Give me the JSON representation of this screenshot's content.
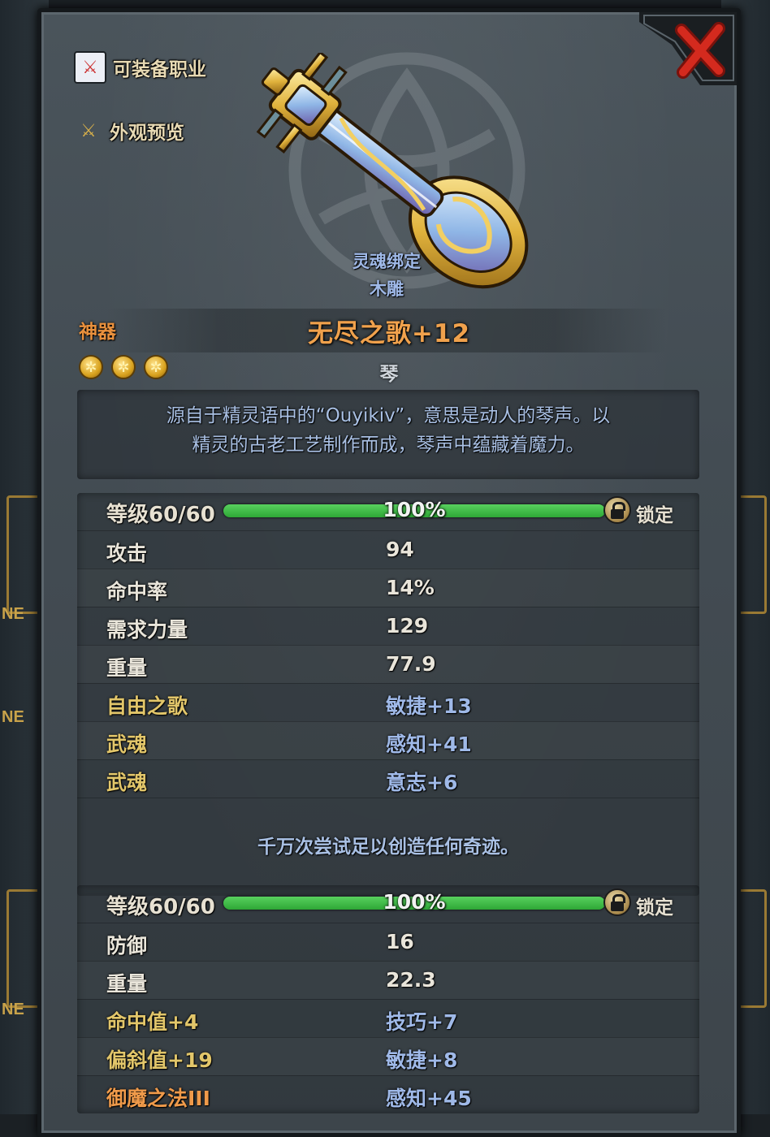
{
  "side_buttons": {
    "equip_class": "可装备职业",
    "appearance_preview": "外观预览"
  },
  "item": {
    "bind_status": "灵魂绑定",
    "material": "木雕",
    "rarity": "神器",
    "name": "无尽之歌+12",
    "type": "琴",
    "star_count": 3,
    "description_line1": "源自于精灵语中的“Ouyikiv”，意思是动人的琴声。以",
    "description_line2": "精灵的古老工艺制作而成，琴声中蕴藏着魔力。"
  },
  "weapon_section": {
    "level_label": "等级60/60",
    "progress_percent": 100,
    "progress_text": "100%",
    "lock_label": "锁定",
    "stats": [
      {
        "name": "攻击",
        "value": "94",
        "name_color": "white",
        "value_color": "white"
      },
      {
        "name": "命中率",
        "value": "14%",
        "name_color": "white",
        "value_color": "white"
      },
      {
        "name": "需求力量",
        "value": "129",
        "name_color": "white",
        "value_color": "white"
      },
      {
        "name": "重量",
        "value": "77.9",
        "name_color": "white",
        "value_color": "white"
      },
      {
        "name": "自由之歌",
        "value": "敏捷+13",
        "name_color": "gold",
        "value_color": "blue"
      },
      {
        "name": "武魂",
        "value": "感知+41",
        "name_color": "gold",
        "value_color": "blue"
      },
      {
        "name": "武魂",
        "value": "意志+6",
        "name_color": "gold",
        "value_color": "blue"
      }
    ],
    "flavor_text": "千万次尝试足以创造任何奇迹。"
  },
  "armor_section": {
    "level_label": "等级60/60",
    "progress_percent": 100,
    "progress_text": "100%",
    "lock_label": "锁定",
    "stats": [
      {
        "name": "防御",
        "value": "16",
        "name_color": "white",
        "value_color": "white"
      },
      {
        "name": "重量",
        "value": "22.3",
        "name_color": "white",
        "value_color": "white"
      },
      {
        "name": "命中值+4",
        "value": "技巧+7",
        "name_color": "gold",
        "value_color": "blue"
      },
      {
        "name": "偏斜值+19",
        "value": "敏捷+8",
        "name_color": "gold",
        "value_color": "blue"
      },
      {
        "name": "御魔之法III",
        "value": "感知+45",
        "name_color": "orange",
        "value_color": "blue"
      }
    ]
  },
  "background_tags": [
    "NE",
    "NE",
    "NE"
  ],
  "colors": {
    "accent_gold": "#e2c66a",
    "stat_blue": "#9fb9e8",
    "item_orange": "#f0a14c",
    "bar_green": "#3fbf46",
    "close_red": "#d42a1e"
  },
  "icons": {
    "close": "close-x-icon",
    "equip_class": "crossed-weapons-icon",
    "appearance": "crossed-swords-icon",
    "lock": "padlock-icon",
    "rating": "gold-hexagon-star-icon"
  }
}
